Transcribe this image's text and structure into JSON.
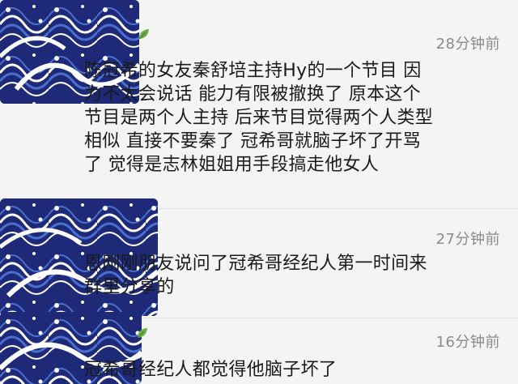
{
  "comments": [
    {
      "time": "28分钟前",
      "lines": [
        "陈冠希的女友秦舒培主持Hy的一个节目 因",
        "为不太会说话 能力有限被撤换了 原本这个",
        "节目是两个人主持 后来节目觉得两个人类型",
        "相似 直接不要秦了 冠希哥就脑子坏了开骂",
        "了 觉得是志林姐姐用手段搞走他女人"
      ]
    },
    {
      "time": "27分钟前",
      "lines": [
        "恩刚刚朋友说问了冠希哥经纪人第一时间来",
        "群里分享的"
      ]
    },
    {
      "time": "16分钟前",
      "lines": [
        "冠希哥经纪人都觉得他脑子坏了"
      ]
    }
  ],
  "colors": {
    "wave_dark": "#1e2a78",
    "wave_mid": "#2f4fb0",
    "wave_light": "#ffffff",
    "timestamp": "#8a8a8a"
  }
}
